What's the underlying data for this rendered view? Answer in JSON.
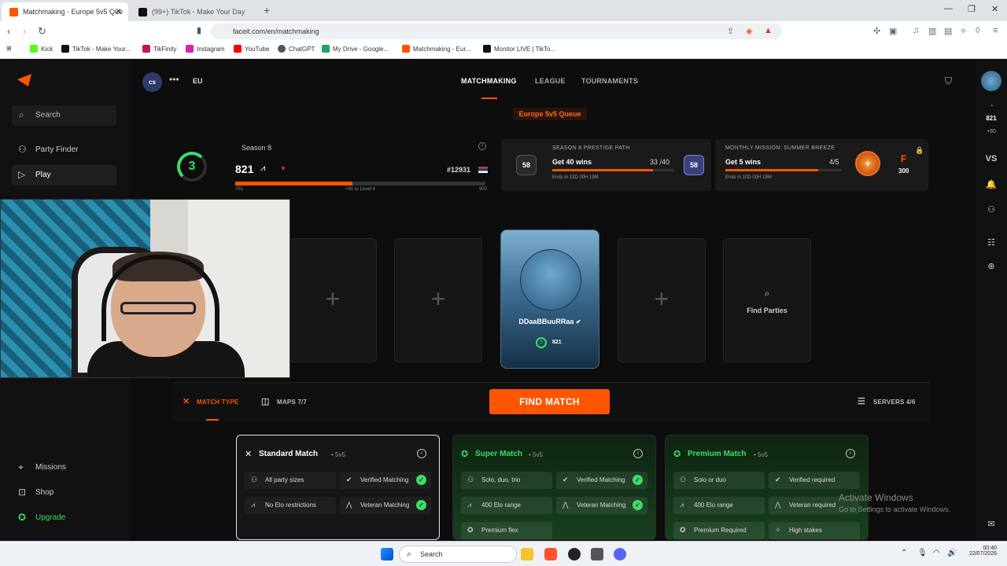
{
  "browser": {
    "tabs": [
      {
        "title": "Matchmaking - Europe 5v5 Que",
        "active": true
      },
      {
        "title": "(99+) TikTok - Make Your Day",
        "active": false
      }
    ],
    "url": "faceit.com/en/matchmaking",
    "bookmarks": [
      "Kick",
      "TikTok - Make Your...",
      "TikFinity",
      "Instagram",
      "YouTube",
      "ChatGPT",
      "My Drive - Google...",
      "Matchmaking - Eur...",
      "Monitor LIVE | TikTo..."
    ]
  },
  "sidebar": {
    "search_label": "Search",
    "items": [
      {
        "label": "Party Finder",
        "icon": "party-finder-icon"
      },
      {
        "label": "Play",
        "icon": "play-icon"
      },
      {
        "label": "Missions",
        "icon": "missions-icon"
      },
      {
        "label": "Shop",
        "icon": "shop-icon"
      },
      {
        "label": "Upgrade",
        "icon": "upgrade-icon"
      }
    ]
  },
  "header": {
    "game": "cs",
    "region": "EU",
    "nav": [
      "MATCHMAKING",
      "LEAGUE",
      "TOURNAMENTS"
    ],
    "queue": "Europe 5v5 Queue"
  },
  "stats": {
    "season": "Season 8",
    "level": "3",
    "elo": "821",
    "rank": "#12931",
    "elo_min": "751",
    "elo_next": "+80 to Level 4",
    "elo_max": "900",
    "elo_progress": 0.47
  },
  "prestige": {
    "heading": "SEASON 8 PRESTIGE PATH",
    "title": "Get 40 wins",
    "count": "33 /40",
    "progress": 0.825,
    "ends": "Ends in 13D 00H 19M",
    "badge": "58"
  },
  "monthly": {
    "heading": "MONTHLY MISSION: SUMMER BREEZE",
    "title": "Get 5 wins",
    "count": "4/5",
    "progress": 0.8,
    "ends": "Ends in 10D 00H 19M",
    "tier": "F",
    "reward": "300"
  },
  "party": {
    "player_name": "DDaaBBuuRRaa",
    "player_level": "3",
    "player_elo": "821",
    "find_parties": "Find Parties"
  },
  "actionbar": {
    "match_type": "MATCH TYPE",
    "maps": "MAPS 7/7",
    "find_match": "FIND MATCH",
    "servers": "SERVERS 4/6"
  },
  "match_types": [
    {
      "name": "Standard Match",
      "size": "5v5",
      "features": [
        "All party sizes",
        "Verified Matching",
        "No Elo restrictions",
        "Veteran Matching"
      ]
    },
    {
      "name": "Super Match",
      "size": "5v5",
      "features": [
        "Solo, duo, trio",
        "Verified Matching",
        "400 Elo range",
        "Veteran Matching",
        "Premium flex"
      ]
    },
    {
      "name": "Premium Match",
      "size": "5v5",
      "features": [
        "Solo or duo",
        "Verified required",
        "400 Elo range",
        "Veteran required",
        "Premium Required",
        "High stakes"
      ]
    }
  ],
  "right_rail": {
    "elo": "821",
    "delta": "+80",
    "vs": "VS"
  },
  "watermark": {
    "line1": "Activate Windows",
    "line2": "Go to Settings to activate Windows."
  },
  "taskbar": {
    "search": "Search",
    "time": "00:40",
    "date": "22/07/2026"
  },
  "colors": {
    "accent": "#ff5500",
    "green": "#3ddc6a"
  }
}
